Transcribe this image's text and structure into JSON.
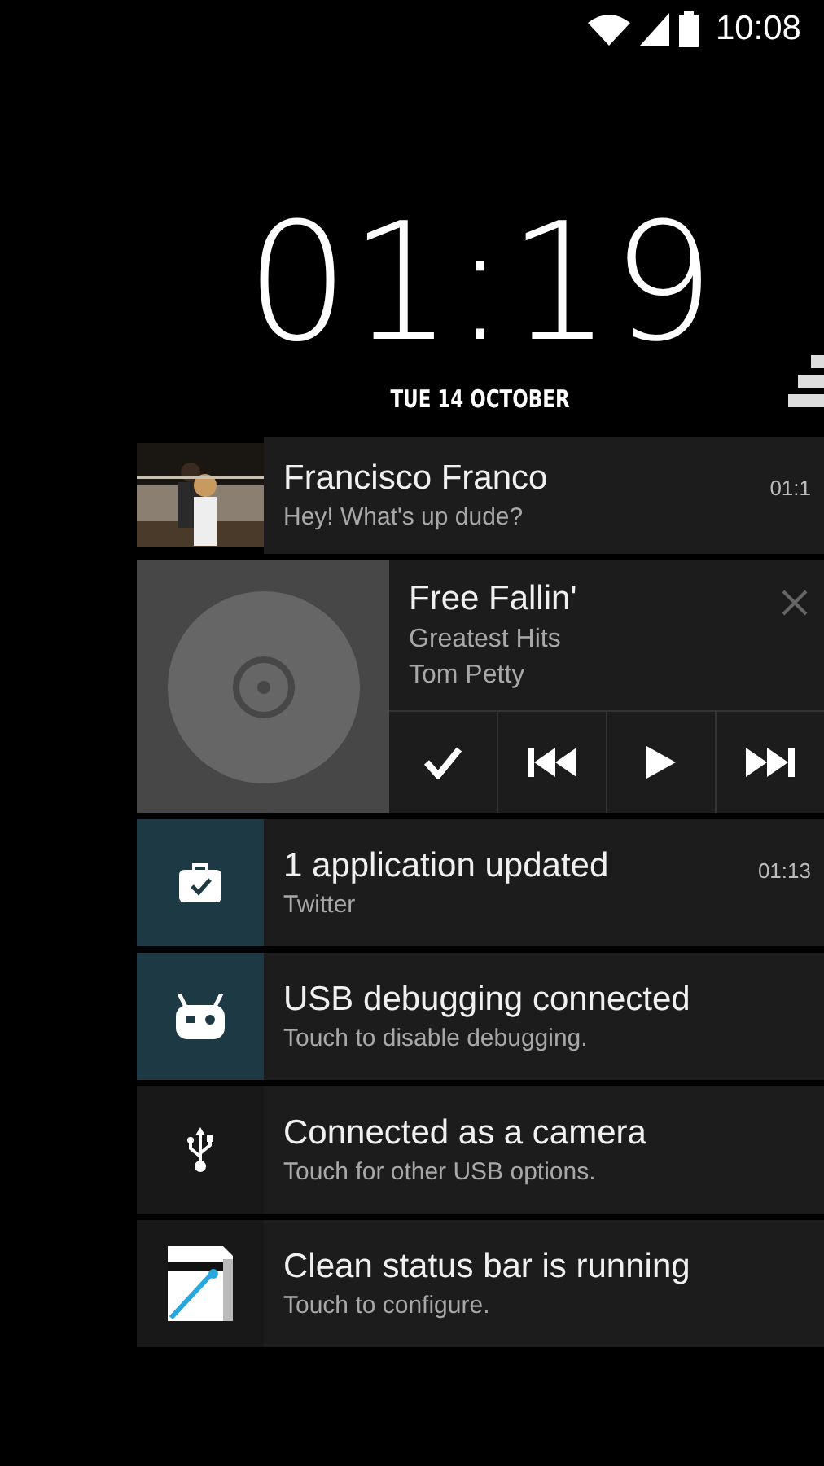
{
  "status_bar": {
    "time": "10:08"
  },
  "lock_clock": {
    "time": "01:19",
    "date": "TUE 14 OCTOBER"
  },
  "notifications": [
    {
      "kind": "contact",
      "title": "Francisco Franco",
      "text": "Hey! What's up dude?",
      "time": "01:1"
    },
    {
      "kind": "media",
      "title": "Free Fallin'",
      "album": "Greatest Hits",
      "artist": "Tom Petty"
    },
    {
      "kind": "app-update",
      "title": "1 application updated",
      "text": "Twitter",
      "time": "01:13"
    },
    {
      "kind": "debugging",
      "title": "USB debugging connected",
      "text": "Touch to disable debugging."
    },
    {
      "kind": "usb",
      "title": "Connected as a camera",
      "text": "Touch for other USB options."
    },
    {
      "kind": "app",
      "title": "Clean status bar is running",
      "text": "Touch to configure."
    }
  ]
}
